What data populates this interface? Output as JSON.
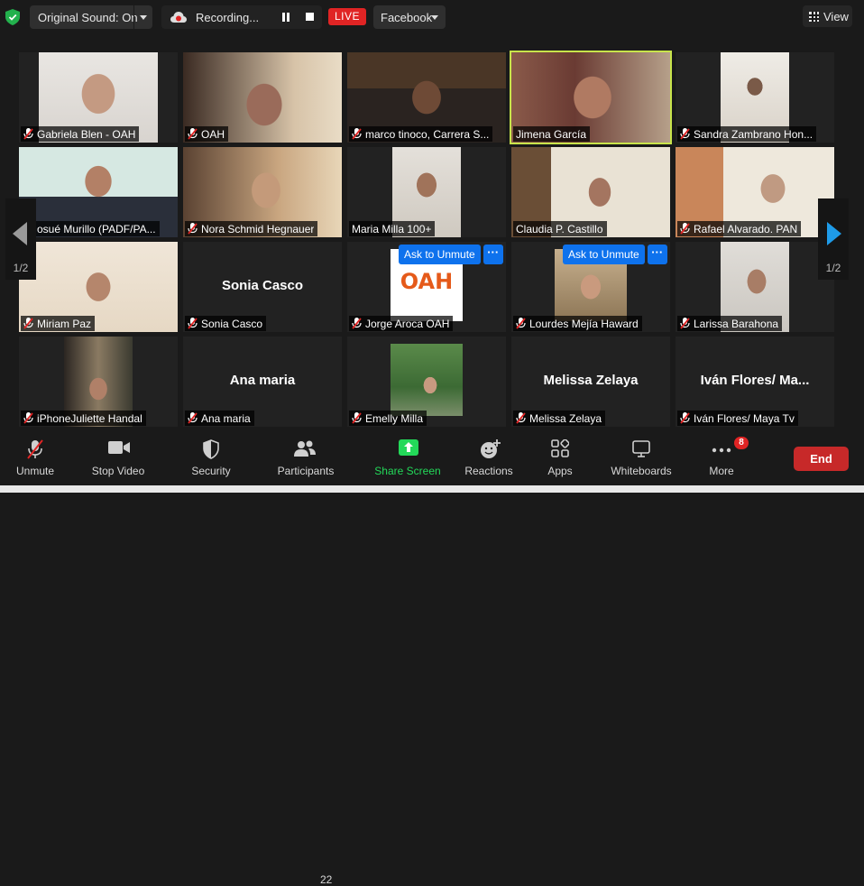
{
  "topbar": {
    "original_sound": "Original Sound: On",
    "recording": "Recording...",
    "live": "LIVE",
    "stream_target": "Facebook",
    "view": "View"
  },
  "colors": {
    "active_speaker_border": "#c8e44b",
    "live_red": "#e02424",
    "ask_unmute_blue": "#0e72ed",
    "share_screen_green": "#23d959",
    "end_red": "#c72929"
  },
  "participants": [
    {
      "name": "Gabriela Blen - OAH",
      "video": true,
      "muted": true
    },
    {
      "name": "OAH",
      "video": true,
      "muted": true
    },
    {
      "name": "marco tinoco, Carrera S...",
      "video": true,
      "muted": true
    },
    {
      "name": "Jimena García",
      "video": true,
      "muted": false,
      "active": true
    },
    {
      "name": "Sandra Zambrano  Hon...",
      "video": true,
      "muted": true
    },
    {
      "name": "osué Murillo (PADF/PA...",
      "video": true,
      "muted": true
    },
    {
      "name": "Nora Schmid Hegnauer",
      "video": true,
      "muted": true
    },
    {
      "name": "Maria Milla 100+",
      "video": true,
      "muted": false
    },
    {
      "name": "Claudia P. Castillo",
      "video": true,
      "muted": false
    },
    {
      "name": "Rafael Alvarado. PAN",
      "video": true,
      "muted": true
    },
    {
      "name": "Miriam Paz",
      "video": true,
      "muted": true
    },
    {
      "name": "Sonia Casco",
      "video": false,
      "muted": true,
      "display": "Sonia Casco"
    },
    {
      "name": "Jorge Aroca OAH",
      "video": true,
      "muted": true,
      "ask_unmute": "Ask to Unmute",
      "logo": "OAH"
    },
    {
      "name": "Lourdes Mejía Haward",
      "video": true,
      "muted": true,
      "ask_unmute": "Ask to Unmute"
    },
    {
      "name": "Larissa Barahona",
      "video": true,
      "muted": true
    },
    {
      "name": "iPhoneJuliette Handal",
      "video": true,
      "muted": true
    },
    {
      "name": "Ana maria",
      "video": false,
      "muted": true,
      "display": "Ana maria"
    },
    {
      "name": "Emelly Milla",
      "video": true,
      "muted": true
    },
    {
      "name": "Melissa Zelaya",
      "video": false,
      "muted": true,
      "display": "Melissa Zelaya"
    },
    {
      "name": "Iván Flores/ Maya Tv",
      "video": false,
      "muted": true,
      "display": "Iván Flores/ Ma..."
    }
  ],
  "pager": {
    "left": "1/2",
    "right": "1/2"
  },
  "toolbar": {
    "unmute": "Unmute",
    "stop_video": "Stop Video",
    "security": "Security",
    "participants": "Participants",
    "participants_count": "22",
    "share_screen": "Share Screen",
    "reactions": "Reactions",
    "apps": "Apps",
    "whiteboards": "Whiteboards",
    "more": "More",
    "more_badge": "8",
    "end": "End"
  }
}
